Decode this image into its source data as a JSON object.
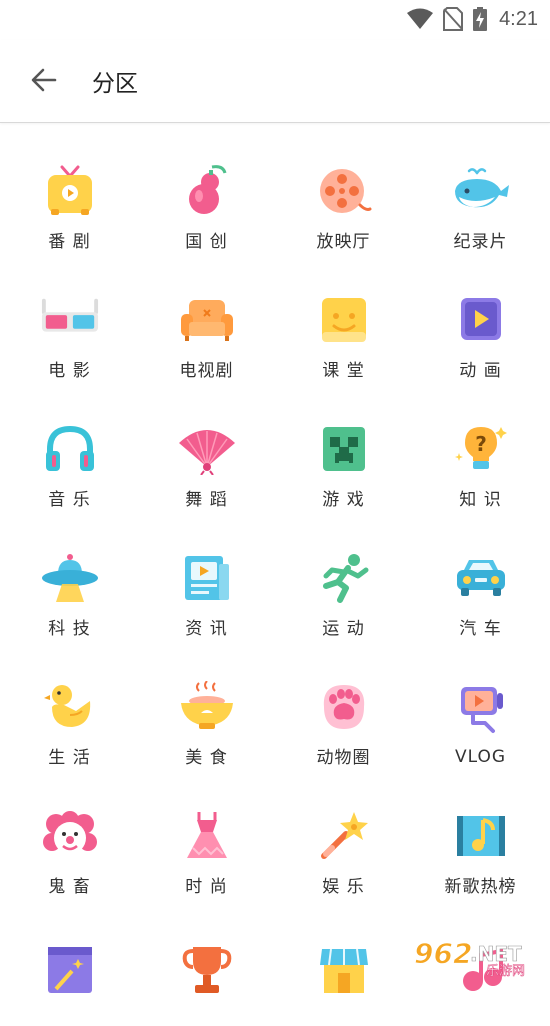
{
  "status_bar": {
    "time": "4:21"
  },
  "header": {
    "title": "分区"
  },
  "categories": [
    {
      "label": "番 剧",
      "icon": "tv-icon"
    },
    {
      "label": "国 创",
      "icon": "gourd-icon"
    },
    {
      "label": "放映厅",
      "icon": "film-reel-icon"
    },
    {
      "label": "纪录片",
      "icon": "whale-icon"
    },
    {
      "label": "电 影",
      "icon": "3d-glasses-icon"
    },
    {
      "label": "电视剧",
      "icon": "sofa-icon"
    },
    {
      "label": "课 堂",
      "icon": "classroom-icon"
    },
    {
      "label": "动 画",
      "icon": "animation-play-icon"
    },
    {
      "label": "音 乐",
      "icon": "headphones-icon"
    },
    {
      "label": "舞 蹈",
      "icon": "fan-icon"
    },
    {
      "label": "游 戏",
      "icon": "creeper-icon"
    },
    {
      "label": "知 识",
      "icon": "lightbulb-question-icon"
    },
    {
      "label": "科 技",
      "icon": "ufo-icon"
    },
    {
      "label": "资 讯",
      "icon": "newspaper-icon"
    },
    {
      "label": "运 动",
      "icon": "runner-icon"
    },
    {
      "label": "汽 车",
      "icon": "car-icon"
    },
    {
      "label": "生 活",
      "icon": "duck-icon"
    },
    {
      "label": "美 食",
      "icon": "food-bowl-icon"
    },
    {
      "label": "动物圈",
      "icon": "paw-icon"
    },
    {
      "label": "VLOG",
      "icon": "vlog-camera-icon"
    },
    {
      "label": "鬼 畜",
      "icon": "clown-icon"
    },
    {
      "label": "时 尚",
      "icon": "dress-icon"
    },
    {
      "label": "娱 乐",
      "icon": "star-wand-icon"
    },
    {
      "label": "新歌热榜",
      "icon": "music-chart-icon"
    },
    {
      "label": "",
      "icon": "magic-board-icon"
    },
    {
      "label": "",
      "icon": "trophy-icon"
    },
    {
      "label": "",
      "icon": "shop-icon"
    },
    {
      "label": "",
      "icon": "music-icon"
    }
  ],
  "watermark": {
    "text_main": "962",
    "text_suffix": ".NET",
    "text_sub": "乐游网"
  },
  "colors": {
    "accent_pink": "#f25d8e",
    "icon_yellow": "#ffd24a",
    "icon_blue": "#52c4e8"
  }
}
